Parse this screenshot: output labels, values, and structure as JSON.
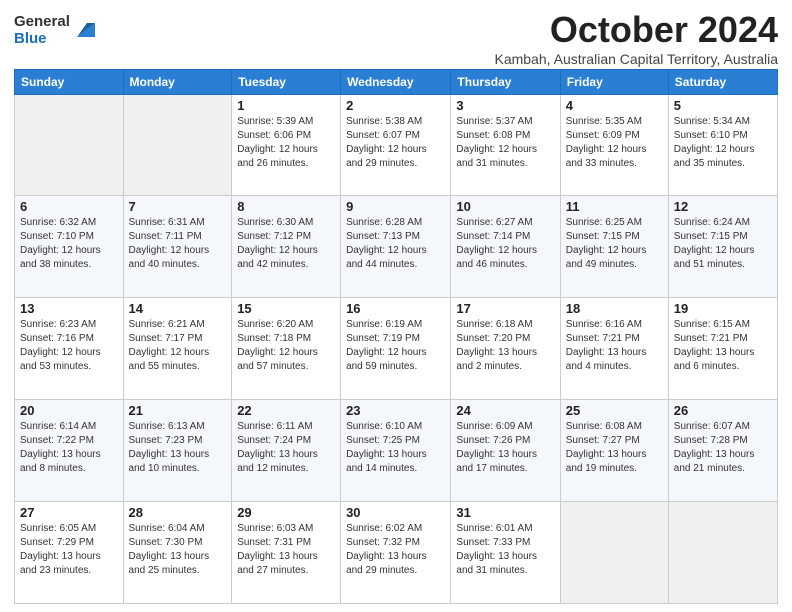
{
  "logo": {
    "general": "General",
    "blue": "Blue"
  },
  "header": {
    "month": "October 2024",
    "location": "Kambah, Australian Capital Territory, Australia"
  },
  "weekdays": [
    "Sunday",
    "Monday",
    "Tuesday",
    "Wednesday",
    "Thursday",
    "Friday",
    "Saturday"
  ],
  "weeks": [
    [
      {
        "day": "",
        "info": ""
      },
      {
        "day": "",
        "info": ""
      },
      {
        "day": "1",
        "info": "Sunrise: 5:39 AM\nSunset: 6:06 PM\nDaylight: 12 hours\nand 26 minutes."
      },
      {
        "day": "2",
        "info": "Sunrise: 5:38 AM\nSunset: 6:07 PM\nDaylight: 12 hours\nand 29 minutes."
      },
      {
        "day": "3",
        "info": "Sunrise: 5:37 AM\nSunset: 6:08 PM\nDaylight: 12 hours\nand 31 minutes."
      },
      {
        "day": "4",
        "info": "Sunrise: 5:35 AM\nSunset: 6:09 PM\nDaylight: 12 hours\nand 33 minutes."
      },
      {
        "day": "5",
        "info": "Sunrise: 5:34 AM\nSunset: 6:10 PM\nDaylight: 12 hours\nand 35 minutes."
      }
    ],
    [
      {
        "day": "6",
        "info": "Sunrise: 6:32 AM\nSunset: 7:10 PM\nDaylight: 12 hours\nand 38 minutes."
      },
      {
        "day": "7",
        "info": "Sunrise: 6:31 AM\nSunset: 7:11 PM\nDaylight: 12 hours\nand 40 minutes."
      },
      {
        "day": "8",
        "info": "Sunrise: 6:30 AM\nSunset: 7:12 PM\nDaylight: 12 hours\nand 42 minutes."
      },
      {
        "day": "9",
        "info": "Sunrise: 6:28 AM\nSunset: 7:13 PM\nDaylight: 12 hours\nand 44 minutes."
      },
      {
        "day": "10",
        "info": "Sunrise: 6:27 AM\nSunset: 7:14 PM\nDaylight: 12 hours\nand 46 minutes."
      },
      {
        "day": "11",
        "info": "Sunrise: 6:25 AM\nSunset: 7:15 PM\nDaylight: 12 hours\nand 49 minutes."
      },
      {
        "day": "12",
        "info": "Sunrise: 6:24 AM\nSunset: 7:15 PM\nDaylight: 12 hours\nand 51 minutes."
      }
    ],
    [
      {
        "day": "13",
        "info": "Sunrise: 6:23 AM\nSunset: 7:16 PM\nDaylight: 12 hours\nand 53 minutes."
      },
      {
        "day": "14",
        "info": "Sunrise: 6:21 AM\nSunset: 7:17 PM\nDaylight: 12 hours\nand 55 minutes."
      },
      {
        "day": "15",
        "info": "Sunrise: 6:20 AM\nSunset: 7:18 PM\nDaylight: 12 hours\nand 57 minutes."
      },
      {
        "day": "16",
        "info": "Sunrise: 6:19 AM\nSunset: 7:19 PM\nDaylight: 12 hours\nand 59 minutes."
      },
      {
        "day": "17",
        "info": "Sunrise: 6:18 AM\nSunset: 7:20 PM\nDaylight: 13 hours\nand 2 minutes."
      },
      {
        "day": "18",
        "info": "Sunrise: 6:16 AM\nSunset: 7:21 PM\nDaylight: 13 hours\nand 4 minutes."
      },
      {
        "day": "19",
        "info": "Sunrise: 6:15 AM\nSunset: 7:21 PM\nDaylight: 13 hours\nand 6 minutes."
      }
    ],
    [
      {
        "day": "20",
        "info": "Sunrise: 6:14 AM\nSunset: 7:22 PM\nDaylight: 13 hours\nand 8 minutes."
      },
      {
        "day": "21",
        "info": "Sunrise: 6:13 AM\nSunset: 7:23 PM\nDaylight: 13 hours\nand 10 minutes."
      },
      {
        "day": "22",
        "info": "Sunrise: 6:11 AM\nSunset: 7:24 PM\nDaylight: 13 hours\nand 12 minutes."
      },
      {
        "day": "23",
        "info": "Sunrise: 6:10 AM\nSunset: 7:25 PM\nDaylight: 13 hours\nand 14 minutes."
      },
      {
        "day": "24",
        "info": "Sunrise: 6:09 AM\nSunset: 7:26 PM\nDaylight: 13 hours\nand 17 minutes."
      },
      {
        "day": "25",
        "info": "Sunrise: 6:08 AM\nSunset: 7:27 PM\nDaylight: 13 hours\nand 19 minutes."
      },
      {
        "day": "26",
        "info": "Sunrise: 6:07 AM\nSunset: 7:28 PM\nDaylight: 13 hours\nand 21 minutes."
      }
    ],
    [
      {
        "day": "27",
        "info": "Sunrise: 6:05 AM\nSunset: 7:29 PM\nDaylight: 13 hours\nand 23 minutes."
      },
      {
        "day": "28",
        "info": "Sunrise: 6:04 AM\nSunset: 7:30 PM\nDaylight: 13 hours\nand 25 minutes."
      },
      {
        "day": "29",
        "info": "Sunrise: 6:03 AM\nSunset: 7:31 PM\nDaylight: 13 hours\nand 27 minutes."
      },
      {
        "day": "30",
        "info": "Sunrise: 6:02 AM\nSunset: 7:32 PM\nDaylight: 13 hours\nand 29 minutes."
      },
      {
        "day": "31",
        "info": "Sunrise: 6:01 AM\nSunset: 7:33 PM\nDaylight: 13 hours\nand 31 minutes."
      },
      {
        "day": "",
        "info": ""
      },
      {
        "day": "",
        "info": ""
      }
    ]
  ]
}
